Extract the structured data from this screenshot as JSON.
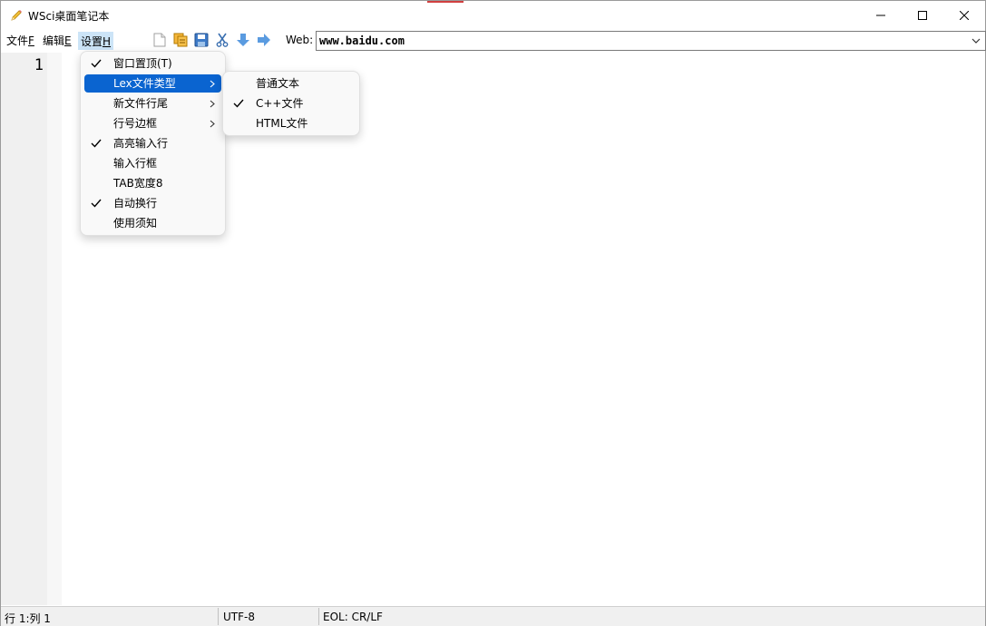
{
  "window": {
    "title": "WSci桌面笔记本",
    "icon": "pencil-icon"
  },
  "menubar": {
    "file": {
      "label": "文件",
      "accel": "F"
    },
    "edit": {
      "label": "编辑",
      "accel": "E"
    },
    "settings": {
      "label": "设置",
      "accel": "H"
    }
  },
  "toolbar": {
    "icons": [
      "new-file-icon",
      "open-file-icon",
      "save-icon",
      "cut-icon",
      "arrow-down-icon",
      "arrow-right-icon"
    ]
  },
  "web": {
    "label": "Web:",
    "value": "www.baidu.com"
  },
  "editor": {
    "line_number": "1"
  },
  "settings_menu": {
    "items": [
      {
        "label": "窗口置顶(T)",
        "checked": true,
        "submenu": false
      },
      {
        "label": "Lex文件类型",
        "checked": false,
        "submenu": true,
        "highlighted": true
      },
      {
        "label": "新文件行尾",
        "checked": false,
        "submenu": true
      },
      {
        "label": "行号边框",
        "checked": false,
        "submenu": true
      },
      {
        "label": "高亮输入行",
        "checked": true,
        "submenu": false
      },
      {
        "label": "输入行框",
        "checked": false,
        "submenu": false
      },
      {
        "label": "TAB宽度8",
        "checked": false,
        "submenu": false
      },
      {
        "label": "自动换行",
        "checked": true,
        "submenu": false
      },
      {
        "label": "使用须知",
        "checked": false,
        "submenu": false
      }
    ]
  },
  "lex_submenu": {
    "items": [
      {
        "label": "普通文本",
        "checked": false
      },
      {
        "label": "C++文件",
        "checked": true
      },
      {
        "label": "HTML文件",
        "checked": false
      }
    ]
  },
  "statusbar": {
    "position": "行 1:列 1",
    "encoding": "UTF-8",
    "eol": "EOL: CR/LF"
  },
  "colors": {
    "highlight": "#0a64d0",
    "menu_active": "#cce4f7",
    "toolbar_blue": "#4a90d9"
  }
}
